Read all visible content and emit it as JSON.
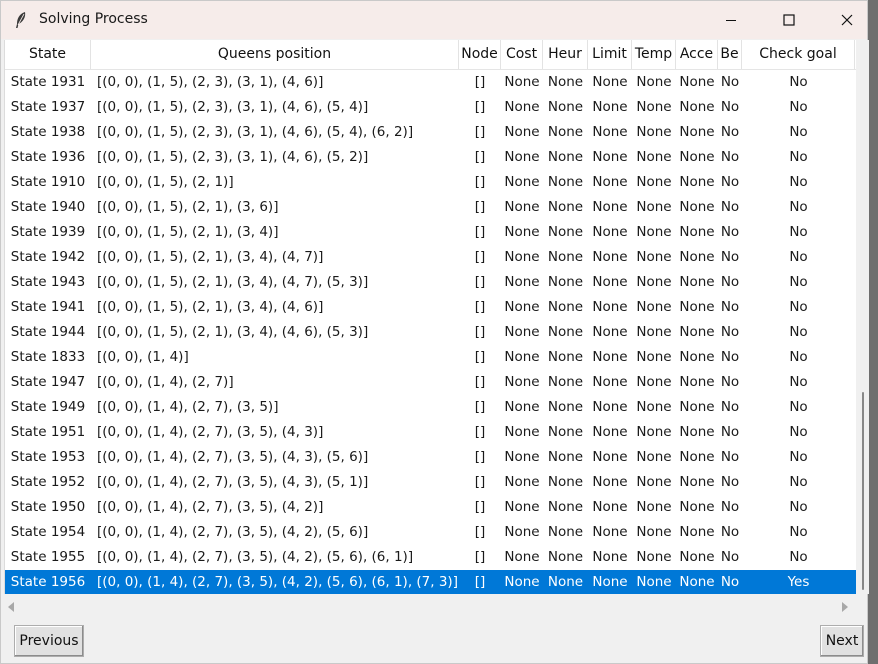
{
  "window": {
    "title": "Solving Process",
    "buttons": {
      "minimize": "—",
      "maximize": "☐",
      "close": "✕"
    }
  },
  "table": {
    "columns": [
      "State",
      "Queens position",
      "Node",
      "Cost",
      "Heur",
      "Limit",
      "Temp",
      "Acce",
      "Be",
      "Check goal"
    ],
    "rows": [
      {
        "state": "State 1931",
        "queens": "[(0, 0), (1, 5), (2, 3), (3, 1), (4, 6)]",
        "node": "[]",
        "cost": "None",
        "heur": "None",
        "limit": "None",
        "temp": "None",
        "acce": "None",
        "be": "No",
        "goal": "No"
      },
      {
        "state": "State 1937",
        "queens": "[(0, 0), (1, 5), (2, 3), (3, 1), (4, 6), (5, 4)]",
        "node": "[]",
        "cost": "None",
        "heur": "None",
        "limit": "None",
        "temp": "None",
        "acce": "None",
        "be": "No",
        "goal": "No"
      },
      {
        "state": "State 1938",
        "queens": "[(0, 0), (1, 5), (2, 3), (3, 1), (4, 6), (5, 4), (6, 2)]",
        "node": "[]",
        "cost": "None",
        "heur": "None",
        "limit": "None",
        "temp": "None",
        "acce": "None",
        "be": "No",
        "goal": "No"
      },
      {
        "state": "State 1936",
        "queens": "[(0, 0), (1, 5), (2, 3), (3, 1), (4, 6), (5, 2)]",
        "node": "[]",
        "cost": "None",
        "heur": "None",
        "limit": "None",
        "temp": "None",
        "acce": "None",
        "be": "No",
        "goal": "No"
      },
      {
        "state": "State 1910",
        "queens": "[(0, 0), (1, 5), (2, 1)]",
        "node": "[]",
        "cost": "None",
        "heur": "None",
        "limit": "None",
        "temp": "None",
        "acce": "None",
        "be": "No",
        "goal": "No"
      },
      {
        "state": "State 1940",
        "queens": "[(0, 0), (1, 5), (2, 1), (3, 6)]",
        "node": "[]",
        "cost": "None",
        "heur": "None",
        "limit": "None",
        "temp": "None",
        "acce": "None",
        "be": "No",
        "goal": "No"
      },
      {
        "state": "State 1939",
        "queens": "[(0, 0), (1, 5), (2, 1), (3, 4)]",
        "node": "[]",
        "cost": "None",
        "heur": "None",
        "limit": "None",
        "temp": "None",
        "acce": "None",
        "be": "No",
        "goal": "No"
      },
      {
        "state": "State 1942",
        "queens": "[(0, 0), (1, 5), (2, 1), (3, 4), (4, 7)]",
        "node": "[]",
        "cost": "None",
        "heur": "None",
        "limit": "None",
        "temp": "None",
        "acce": "None",
        "be": "No",
        "goal": "No"
      },
      {
        "state": "State 1943",
        "queens": "[(0, 0), (1, 5), (2, 1), (3, 4), (4, 7), (5, 3)]",
        "node": "[]",
        "cost": "None",
        "heur": "None",
        "limit": "None",
        "temp": "None",
        "acce": "None",
        "be": "No",
        "goal": "No"
      },
      {
        "state": "State 1941",
        "queens": "[(0, 0), (1, 5), (2, 1), (3, 4), (4, 6)]",
        "node": "[]",
        "cost": "None",
        "heur": "None",
        "limit": "None",
        "temp": "None",
        "acce": "None",
        "be": "No",
        "goal": "No"
      },
      {
        "state": "State 1944",
        "queens": "[(0, 0), (1, 5), (2, 1), (3, 4), (4, 6), (5, 3)]",
        "node": "[]",
        "cost": "None",
        "heur": "None",
        "limit": "None",
        "temp": "None",
        "acce": "None",
        "be": "No",
        "goal": "No"
      },
      {
        "state": "State 1833",
        "queens": "[(0, 0), (1, 4)]",
        "node": "[]",
        "cost": "None",
        "heur": "None",
        "limit": "None",
        "temp": "None",
        "acce": "None",
        "be": "No",
        "goal": "No"
      },
      {
        "state": "State 1947",
        "queens": "[(0, 0), (1, 4), (2, 7)]",
        "node": "[]",
        "cost": "None",
        "heur": "None",
        "limit": "None",
        "temp": "None",
        "acce": "None",
        "be": "No",
        "goal": "No"
      },
      {
        "state": "State 1949",
        "queens": "[(0, 0), (1, 4), (2, 7), (3, 5)]",
        "node": "[]",
        "cost": "None",
        "heur": "None",
        "limit": "None",
        "temp": "None",
        "acce": "None",
        "be": "No",
        "goal": "No"
      },
      {
        "state": "State 1951",
        "queens": "[(0, 0), (1, 4), (2, 7), (3, 5), (4, 3)]",
        "node": "[]",
        "cost": "None",
        "heur": "None",
        "limit": "None",
        "temp": "None",
        "acce": "None",
        "be": "No",
        "goal": "No"
      },
      {
        "state": "State 1953",
        "queens": "[(0, 0), (1, 4), (2, 7), (3, 5), (4, 3), (5, 6)]",
        "node": "[]",
        "cost": "None",
        "heur": "None",
        "limit": "None",
        "temp": "None",
        "acce": "None",
        "be": "No",
        "goal": "No"
      },
      {
        "state": "State 1952",
        "queens": "[(0, 0), (1, 4), (2, 7), (3, 5), (4, 3), (5, 1)]",
        "node": "[]",
        "cost": "None",
        "heur": "None",
        "limit": "None",
        "temp": "None",
        "acce": "None",
        "be": "No",
        "goal": "No"
      },
      {
        "state": "State 1950",
        "queens": "[(0, 0), (1, 4), (2, 7), (3, 5), (4, 2)]",
        "node": "[]",
        "cost": "None",
        "heur": "None",
        "limit": "None",
        "temp": "None",
        "acce": "None",
        "be": "No",
        "goal": "No"
      },
      {
        "state": "State 1954",
        "queens": "[(0, 0), (1, 4), (2, 7), (3, 5), (4, 2), (5, 6)]",
        "node": "[]",
        "cost": "None",
        "heur": "None",
        "limit": "None",
        "temp": "None",
        "acce": "None",
        "be": "No",
        "goal": "No"
      },
      {
        "state": "State 1955",
        "queens": "[(0, 0), (1, 4), (2, 7), (3, 5), (4, 2), (5, 6), (6, 1)]",
        "node": "[]",
        "cost": "None",
        "heur": "None",
        "limit": "None",
        "temp": "None",
        "acce": "None",
        "be": "No",
        "goal": "No"
      },
      {
        "state": "State 1956",
        "queens": "[(0, 0), (1, 4), (2, 7), (3, 5), (4, 2), (5, 6), (6, 1), (7, 3)]",
        "node": "[]",
        "cost": "None",
        "heur": "None",
        "limit": "None",
        "temp": "None",
        "acce": "None",
        "be": "No",
        "goal": "Yes",
        "selected": true
      }
    ]
  },
  "footer": {
    "previous": "Previous",
    "next": "Next"
  },
  "colors": {
    "selection": "#0078d7",
    "titlebar": "#f6ecea"
  }
}
